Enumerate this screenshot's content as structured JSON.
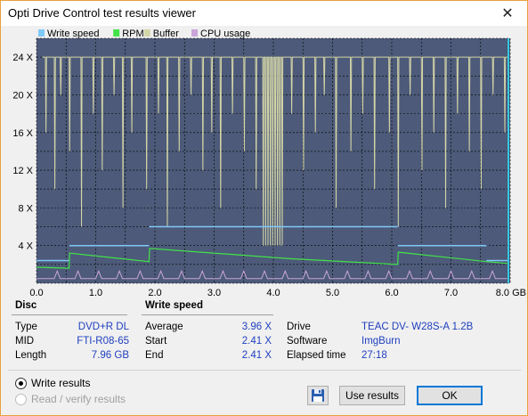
{
  "window": {
    "title": "Opti Drive Control test results viewer",
    "close_glyph": "✕"
  },
  "chart_data": {
    "type": "line",
    "legend": [
      "Write speed",
      "RPM",
      "Buffer",
      "CPU usage"
    ],
    "legend_colors": [
      "#7fc8f8",
      "#42e24a",
      "#d4d6a8",
      "#c9a5d9"
    ],
    "y_ticks": [
      "24 X",
      "20 X",
      "16 X",
      "12 X",
      "8 X",
      "4 X"
    ],
    "y_tick_values": [
      24,
      20,
      16,
      12,
      8,
      4
    ],
    "x_ticks": [
      "0.0",
      "1.0",
      "2.0",
      "3.0",
      "4.0",
      "5.0",
      "6.0",
      "7.0",
      "8.0 GB"
    ],
    "x_tick_values": [
      0,
      1,
      2,
      3,
      4,
      5,
      6,
      7,
      8
    ],
    "xlim": [
      0,
      8
    ],
    "ylim": [
      0,
      26
    ],
    "write_speed_steps": [
      {
        "x0": 0.0,
        "x1": 0.55,
        "y": 2.41
      },
      {
        "x0": 0.55,
        "x1": 1.9,
        "y": 4.0
      },
      {
        "x0": 1.9,
        "x1": 4.3,
        "y": 6.0
      },
      {
        "x0": 4.3,
        "x1": 6.1,
        "y": 6.0
      },
      {
        "x0": 6.1,
        "x1": 7.6,
        "y": 4.0
      },
      {
        "x0": 7.6,
        "x1": 7.96,
        "y": 2.41
      }
    ],
    "rpm_points": [
      [
        0.0,
        1.7
      ],
      [
        0.55,
        1.6
      ],
      [
        0.56,
        3.2
      ],
      [
        1.9,
        2.3
      ],
      [
        1.91,
        3.7
      ],
      [
        4.3,
        2.6
      ],
      [
        4.31,
        2.6
      ],
      [
        6.1,
        2.0
      ],
      [
        6.11,
        3.3
      ],
      [
        7.6,
        2.3
      ],
      [
        7.96,
        2.1
      ]
    ],
    "buffer_level": 24,
    "cpu_level": 0.5,
    "colors": {
      "plot_bg": "#4d5a79",
      "grid": "#000000",
      "write_speed": "#7fc8f8",
      "rpm": "#42e24a",
      "buffer": "#d4d6a8",
      "cpu": "#c9a5d9",
      "end_marker": "#36c8e0"
    }
  },
  "disc": {
    "heading": "Disc",
    "type_label": "Type",
    "type_value": "DVD+R DL",
    "mid_label": "MID",
    "mid_value": "FTI-R08-65",
    "length_label": "Length",
    "length_value": "7.96 GB"
  },
  "write_speed": {
    "heading": "Write speed",
    "average_label": "Average",
    "average_value": "3.96 X",
    "start_label": "Start",
    "start_value": "2.41 X",
    "end_label": "End",
    "end_value": "2.41 X"
  },
  "info": {
    "drive_label": "Drive",
    "drive_value": "TEAC DV- W28S-A 1.2B",
    "software_label": "Software",
    "software_value": "ImgBurn",
    "elapsed_label": "Elapsed time",
    "elapsed_value": "27:18"
  },
  "options": {
    "write_results": "Write results",
    "read_verify_results": "Read / verify results"
  },
  "buttons": {
    "save_icon": "floppy-disk",
    "use_results": "Use results",
    "ok": "OK"
  }
}
